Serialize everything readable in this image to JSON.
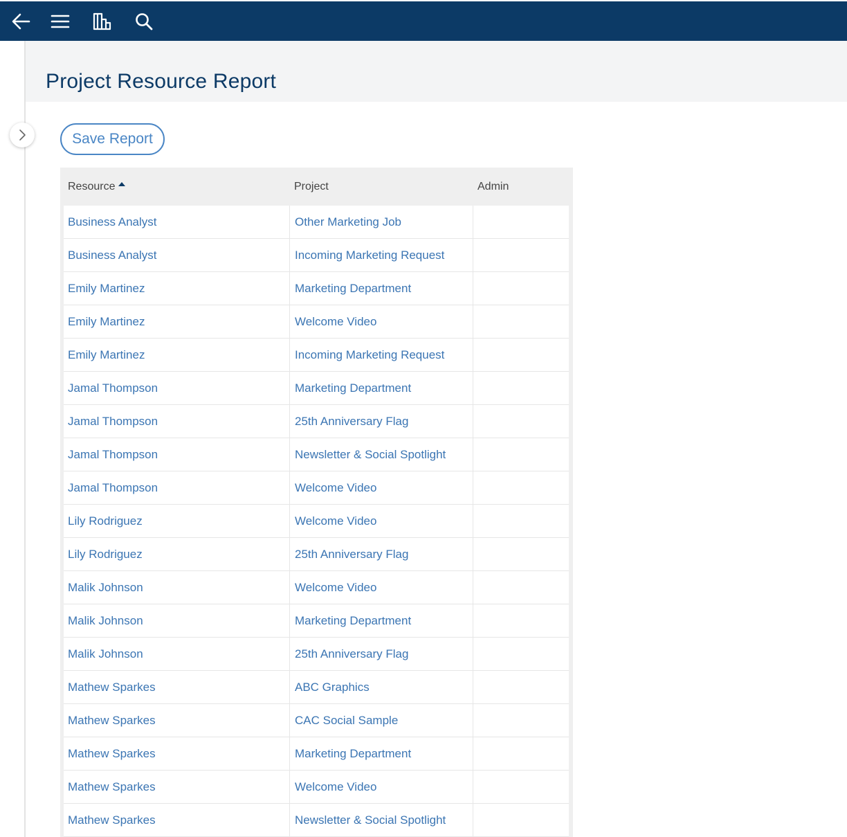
{
  "toolbar": {
    "back_icon": "arrow-left-icon",
    "menu_icon": "hamburger-menu-icon",
    "reports_icon": "bar-chart-icon",
    "search_icon": "search-icon"
  },
  "page": {
    "title": "Project Resource Report",
    "save_button": "Save Report"
  },
  "table": {
    "columns": [
      "Resource",
      "Project",
      "Admin"
    ],
    "sorted_column": "Resource",
    "sort_direction": "ascending",
    "rows": [
      {
        "resource": "Business Analyst",
        "project": "Other Marketing Job",
        "admin": ""
      },
      {
        "resource": "Business Analyst",
        "project": "Incoming Marketing Request",
        "admin": ""
      },
      {
        "resource": "Emily Martinez",
        "project": "Marketing Department",
        "admin": ""
      },
      {
        "resource": "Emily Martinez",
        "project": "Welcome Video",
        "admin": ""
      },
      {
        "resource": "Emily Martinez",
        "project": "Incoming Marketing Request",
        "admin": ""
      },
      {
        "resource": "Jamal Thompson",
        "project": "Marketing Department",
        "admin": ""
      },
      {
        "resource": "Jamal Thompson",
        "project": "25th Anniversary Flag",
        "admin": ""
      },
      {
        "resource": "Jamal Thompson",
        "project": "Newsletter & Social Spotlight",
        "admin": ""
      },
      {
        "resource": "Jamal Thompson",
        "project": "Welcome Video",
        "admin": ""
      },
      {
        "resource": "Lily Rodriguez",
        "project": "Welcome Video",
        "admin": ""
      },
      {
        "resource": "Lily Rodriguez",
        "project": "25th Anniversary Flag",
        "admin": ""
      },
      {
        "resource": "Malik Johnson",
        "project": "Welcome Video",
        "admin": ""
      },
      {
        "resource": "Malik Johnson",
        "project": "Marketing Department",
        "admin": ""
      },
      {
        "resource": "Malik Johnson",
        "project": "25th Anniversary Flag",
        "admin": ""
      },
      {
        "resource": "Mathew Sparkes",
        "project": "ABC Graphics",
        "admin": ""
      },
      {
        "resource": "Mathew Sparkes",
        "project": "CAC Social Sample",
        "admin": ""
      },
      {
        "resource": "Mathew Sparkes",
        "project": "Marketing Department",
        "admin": ""
      },
      {
        "resource": "Mathew Sparkes",
        "project": "Welcome Video",
        "admin": ""
      },
      {
        "resource": "Mathew Sparkes",
        "project": "Newsletter & Social Spotlight",
        "admin": ""
      }
    ]
  },
  "colors": {
    "topbar": "#0c3a66",
    "link": "#3b75b3",
    "title": "#0c3a66",
    "accent": "#4a86c5"
  }
}
